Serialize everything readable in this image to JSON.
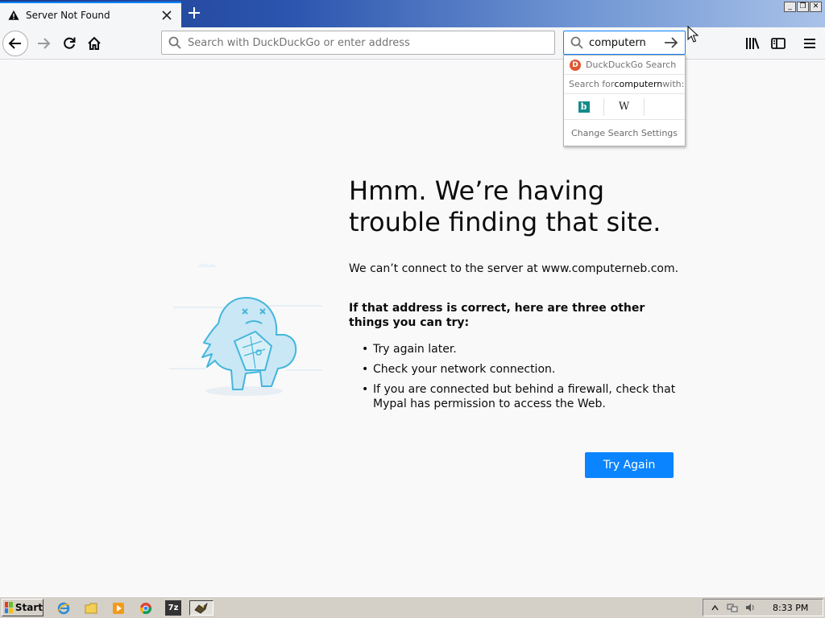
{
  "tab": {
    "title": "Server Not Found"
  },
  "urlbar": {
    "placeholder": "Search with DuckDuckGo or enter address",
    "value": ""
  },
  "searchbar": {
    "value": "computern"
  },
  "search_popup": {
    "engine_label": "DuckDuckGo Search",
    "search_for_prefix": "Search for ",
    "search_for_term": "computern",
    "search_for_suffix": " with:",
    "engines": [
      "Bing",
      "Wikipedia"
    ],
    "settings_label": "Change Search Settings"
  },
  "error": {
    "title": "Hmm. We’re having trouble finding that site.",
    "description": "We can’t connect to the server at www.computerneb.com.",
    "subtitle": "If that address is correct, here are three other things you can try:",
    "suggestions": [
      "Try again later.",
      "Check your network connection.",
      "If you are connected but behind a firewall, check that Mypal has permission to access the Web."
    ],
    "try_again_label": "Try Again"
  },
  "taskbar": {
    "start_label": "Start",
    "clock": "8:33 PM"
  },
  "colors": {
    "accent": "#0a84ff",
    "page_bg": "#f9f9fa",
    "titlebar_start": "#1d3a8c",
    "taskbar": "#d4d0c8"
  }
}
